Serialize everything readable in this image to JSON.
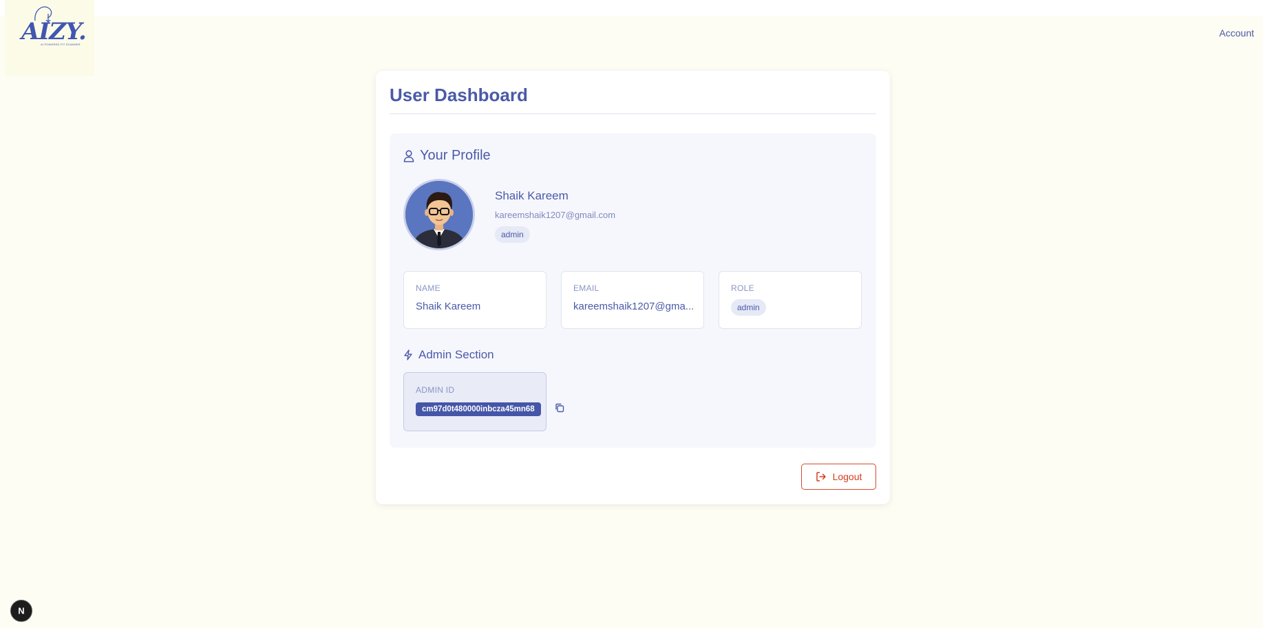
{
  "brand": {
    "logo_text": "AIZY.",
    "logo_tagline": "AI POWERED FIT SCANNER"
  },
  "header": {
    "account_label": "Account"
  },
  "dashboard": {
    "title": "User Dashboard"
  },
  "profile": {
    "heading": "Your Profile",
    "name": "Shaik Kareem",
    "email": "kareemshaik1207@gmail.com",
    "role": "admin"
  },
  "info_cards": [
    {
      "label": "NAME",
      "value": "Shaik Kareem"
    },
    {
      "label": "EMAIL",
      "value": "kareemshaik1207@gma..."
    },
    {
      "label": "ROLE",
      "value": "admin"
    }
  ],
  "admin": {
    "heading": "Admin Section",
    "id_label": "ADMIN ID",
    "id_value": "cm97d0t480000inbcza45mn68"
  },
  "actions": {
    "logout_label": "Logout"
  },
  "dev_badge": {
    "letter": "N"
  },
  "colors": {
    "accent": "#4a5aa8",
    "background": "#fdfdf3",
    "danger": "#d23d1e",
    "panel": "#f6f7fd"
  }
}
